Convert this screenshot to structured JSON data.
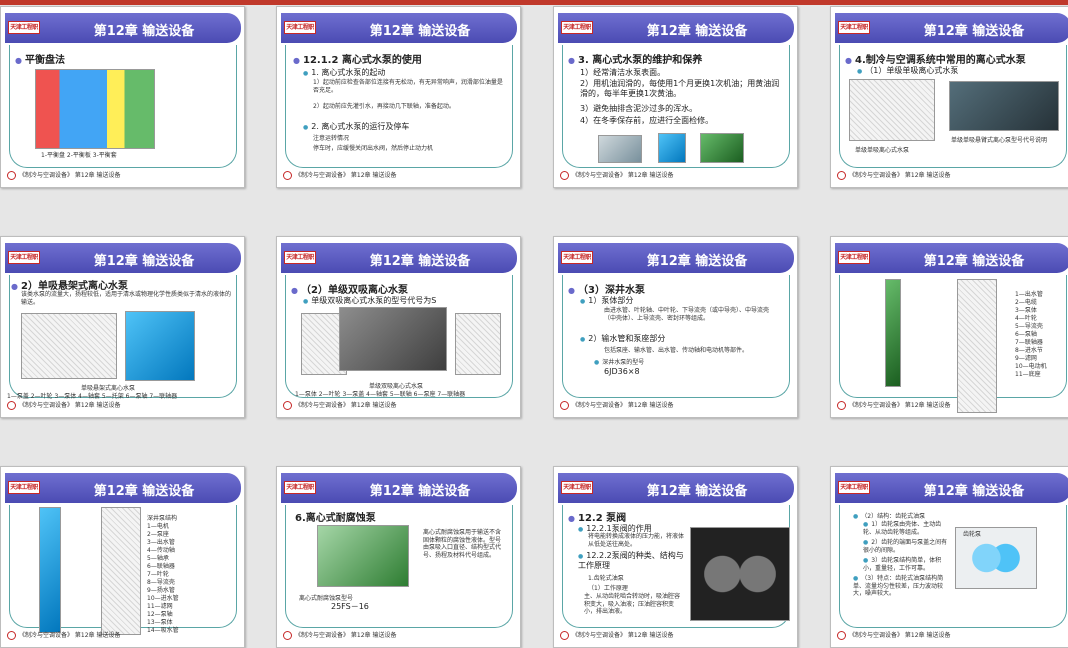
{
  "colors": {
    "accent": "#c0392b",
    "header": "#5858c0",
    "frame": "#5aa6a6"
  },
  "logo_text": "天津工程职业",
  "footer_text": "《制冷与空调设备》 第12章 输送设备",
  "slides": [
    {
      "title": "第12章 输送设备",
      "l1": "平衡盘法",
      "caption": "1-平衡盘 2-平衡板 3-平衡套"
    },
    {
      "title": "第12章 输送设备",
      "l1": "12.1.2 离心式水泵的使用",
      "l2a": "1. 离心式水泵的起动",
      "l3a": "1）起动前应检查各部位连接有无松动，有无异常响声，润滑部位油量是否充足。",
      "l3b": "2）起动前应先灌引水，再接动几下联轴，准备起动。",
      "l2b": "2. 离心式水泵的运行及停车",
      "l3c": "注意运转情况",
      "l3d": "停车时，应缓慢关闭出水阀，然后停止动力机"
    },
    {
      "title": "第12章 输送设备",
      "l1": "3. 离心式水泵的维护和保养",
      "l2a": "1）经常清洁水泵表面。",
      "l2b": "2）用机油润滑的，每使用1个月更换1次机油；用黄油润滑的，每半年更换1次黄油。",
      "l2c": "3）避免抽排含泥沙过多的浑水。",
      "l2d": "4）在冬季保存前，应进行全面检修。"
    },
    {
      "title": "第12章 输送设备",
      "l1": "4.制冷与空调系统中常用的离心式水泵",
      "l2a": "（1）单级单吸离心式水泵",
      "cap1": "单级单吸离心式水泵",
      "cap2": "单级单吸悬臂式离心泵型号代号说明"
    },
    {
      "title": "第12章 输送设备",
      "l1": "2）单吸悬架式离心水泵",
      "l3a": "该类水泵的流量大，扬程较低，适用于清水或物理化学性质类似于清水的液体的输送。",
      "cap1": "单吸悬架式离心水泵",
      "cap2": "1—泵盖 2—叶轮 3—泵体 4—轴套 5—托架 6—泵轴 7—联轴器"
    },
    {
      "title": "第12章 输送设备",
      "l1": "（2）单级双吸离心水泵",
      "l2a": "单级双吸离心式水泵的型号代号为S",
      "cap1": "单级双吸离心式水泵",
      "cap2": "1—泵体 2—叶轮 3—泵盖 4—轴套 5—联轴 6—泵座 7—联轴器"
    },
    {
      "title": "第12章 输送设备",
      "l1": "（3）深井水泵",
      "l2a": "1）泵体部分",
      "l3a": "由进水管、叶轮轴、中叶轮、下导流壳（或中导壳）、中导流壳（中壳体）、上导流壳、密封环等组成。",
      "l2b": "2）输水管和泵座部分",
      "l3b": "包括泵座、输水管、出水管、传动轴和电动机等部件。",
      "l3c": "深井水泵的型号",
      "model": "6JD36×8"
    },
    {
      "title": "第12章 输送设备",
      "parts": [
        "1—出水管",
        "2—电缆",
        "3—泵体",
        "4—叶轮",
        "5—导流壳",
        "6—泵轴",
        "7—联轴器",
        "8—进水节",
        "9—滤网",
        "10—电动机",
        "11—底座"
      ]
    },
    {
      "title": "第12章 输送设备",
      "parts": [
        "深井泵结构",
        "1—电机",
        "2—泵座",
        "3—出水管",
        "4—传动轴",
        "5—轴承",
        "6—联轴器",
        "7—叶轮",
        "8—导流壳",
        "9—扬水管",
        "10—进水管",
        "11—滤网",
        "12—泵轴",
        "13—泵体",
        "14—吸水管"
      ]
    },
    {
      "title": "第12章 输送设备",
      "l1": "6.离心式耐腐蚀泵",
      "desc": "离心式耐腐蚀泵用于输送不含固体颗粒的腐蚀性液体。型号由泵吸入口直径、结构型式代号、扬程及材料代号组成。",
      "cap": "离心式耐腐蚀泵型号",
      "model": "25FS－16"
    },
    {
      "title": "第12章 输送设备",
      "l1": "12.2 泵阀",
      "l2a": "12.2.1泵阀的作用",
      "l3a": "将电能转换成液体的压力能，将液体从低处送往高处。",
      "l2b": "12.2.2泵阀的种类、结构与工作原理",
      "l3b": "1.齿轮式油泵",
      "l3c": "（1）工作原理",
      "l3d": "主、从动齿轮啮合转动时，吸油腔容积变大，吸入油液；压油腔容积变小，排出油液。"
    },
    {
      "title": "第12章 输送设备",
      "l3a": "（2）结构：齿轮式油泵",
      "l3b": "1）齿轮泵由壳体、主动齿轮、从动齿轮等组成。",
      "l3c": "2）齿轮的端面与泵盖之间有很小的间隙。",
      "l3d": "3）齿轮泵结构简单，体积小，重量轻，工作可靠。",
      "l3e": "（3）特点：齿轮式油泵结构简单、流量均匀性较差，压力波动较大，噪声较大。",
      "cap": "齿轮泵"
    }
  ]
}
